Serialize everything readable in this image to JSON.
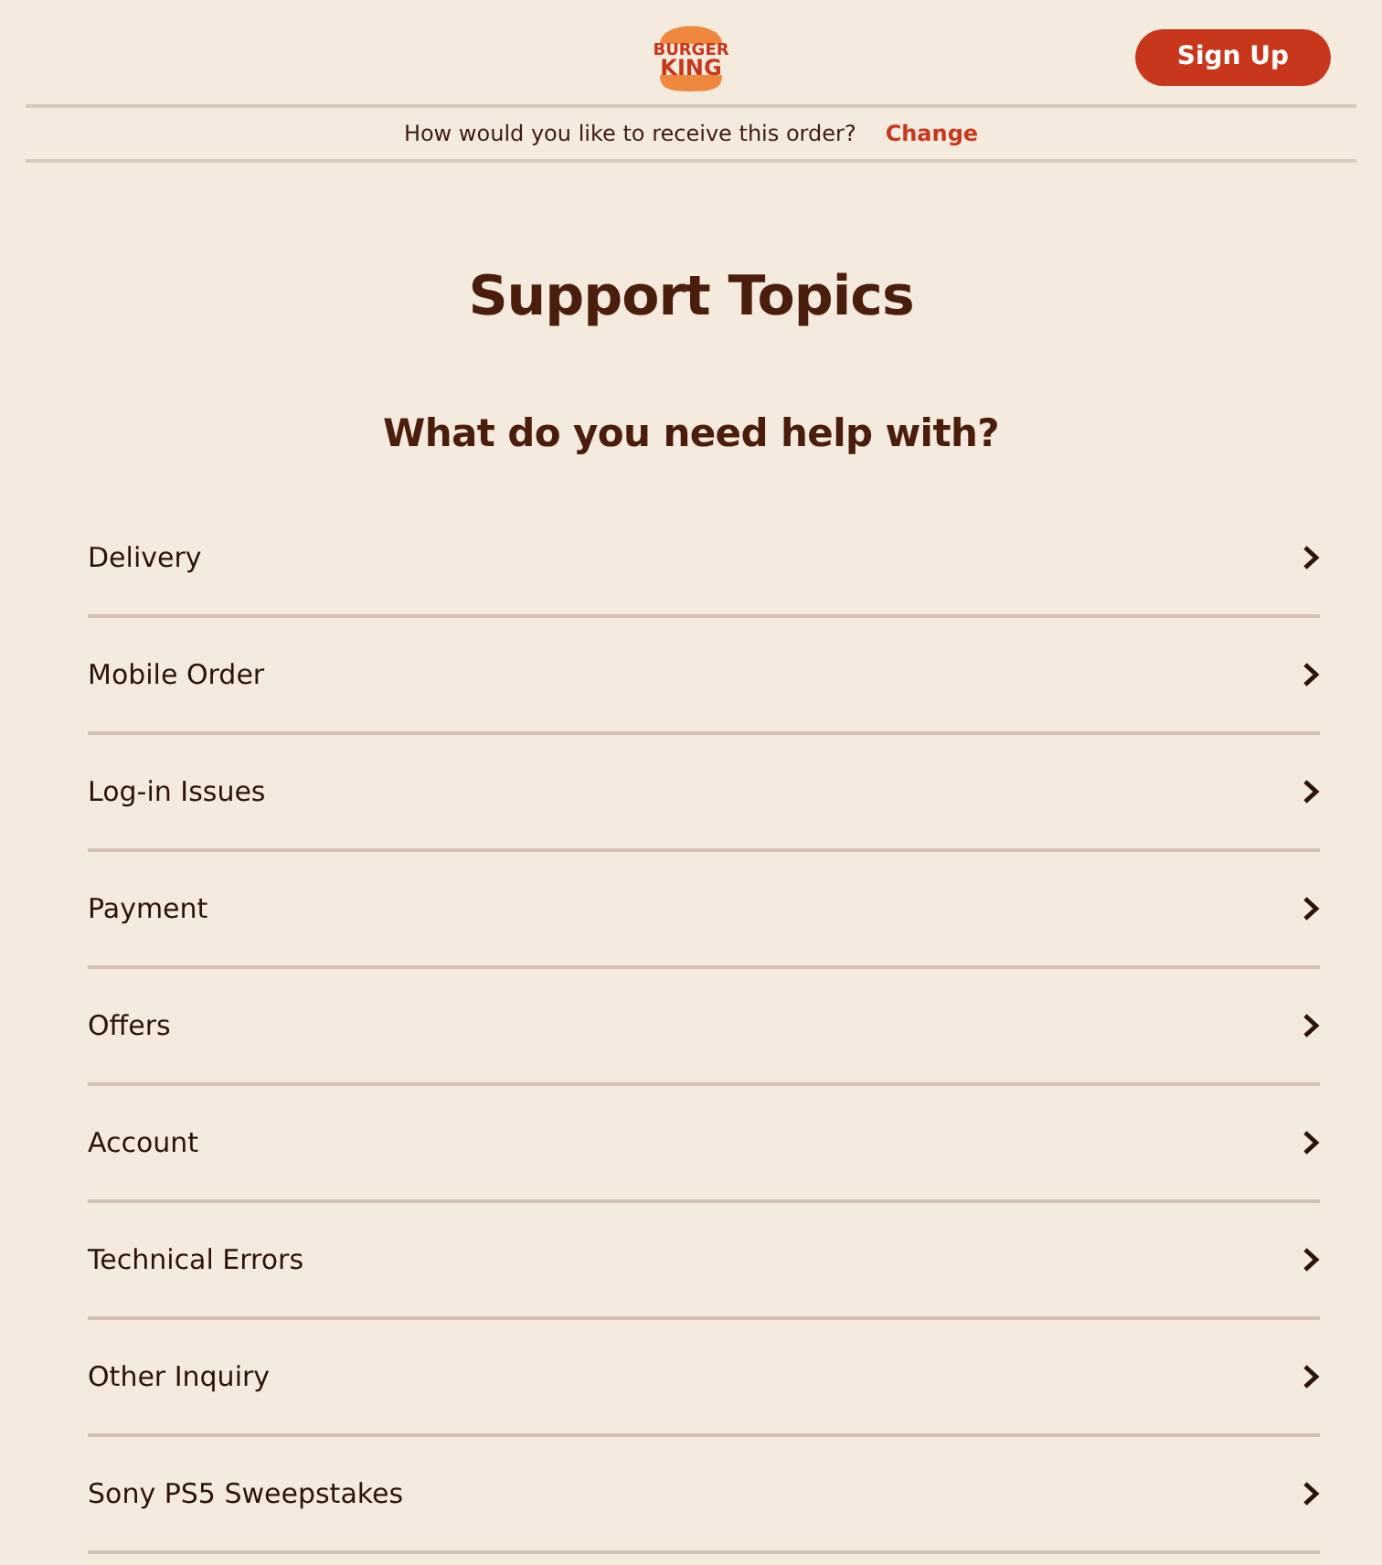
{
  "header": {
    "logo": [
      "BURGER",
      "KING"
    ],
    "sign_up": "Sign Up"
  },
  "order_bar": {
    "question": "How would you like to receive this order?",
    "change": "Change"
  },
  "title": "Support Topics",
  "subtitle": "What do you need help with?",
  "topics": [
    {
      "label": "Delivery"
    },
    {
      "label": "Mobile Order"
    },
    {
      "label": "Log-in Issues"
    },
    {
      "label": "Payment"
    },
    {
      "label": "Offers"
    },
    {
      "label": "Account"
    },
    {
      "label": "Technical Errors"
    },
    {
      "label": "Other Inquiry"
    },
    {
      "label": "Sony PS5 Sweepstakes"
    }
  ]
}
